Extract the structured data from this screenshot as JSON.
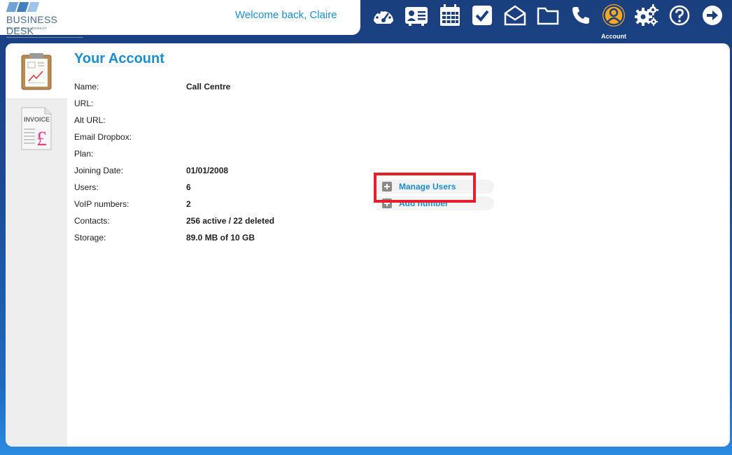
{
  "header": {
    "logo_name": "BUSINESS DESK",
    "logo_tagline": "OFFICE MANAGEMENT",
    "welcome": "Welcome back, Claire",
    "nav": [
      {
        "icon": "dashboard-icon"
      },
      {
        "icon": "contacts-card-icon"
      },
      {
        "icon": "calendar-icon"
      },
      {
        "icon": "tasks-check-icon"
      },
      {
        "icon": "mail-icon"
      },
      {
        "icon": "folder-icon"
      },
      {
        "icon": "phone-icon"
      },
      {
        "icon": "account-user-icon",
        "label": "Account",
        "active": true
      },
      {
        "icon": "settings-gears-icon"
      },
      {
        "icon": "help-icon"
      },
      {
        "icon": "logout-arrow-icon"
      }
    ]
  },
  "sidebar": {
    "items": [
      {
        "icon": "account-clipboard-icon",
        "active": true
      },
      {
        "icon": "invoice-icon",
        "icon_text": "INVOICE"
      }
    ]
  },
  "account": {
    "title": "Your Account",
    "fields": [
      {
        "label": "Name:",
        "value": "Call Centre"
      },
      {
        "label": "URL:",
        "value": ""
      },
      {
        "label": "Alt URL:",
        "value": ""
      },
      {
        "label": "Email Dropbox:",
        "value": ""
      },
      {
        "label": "Plan:",
        "value": ""
      },
      {
        "label": "Joining Date:",
        "value": "01/01/2008"
      },
      {
        "label": "Users:",
        "value": "6"
      },
      {
        "label": "VoIP numbers:",
        "value": "2"
      },
      {
        "label": "Contacts:",
        "value": "256 active / 22 deleted"
      },
      {
        "label": "Storage:",
        "value": "89.0 MB of 10 GB"
      }
    ],
    "actions": [
      {
        "label": "Manage Users"
      },
      {
        "label": "Add number"
      }
    ]
  },
  "colors": {
    "accent": "#1b8ed0",
    "header_bg": "#1a3f7e",
    "highlight": "#e5202a",
    "account_icon": "#f5a623"
  }
}
